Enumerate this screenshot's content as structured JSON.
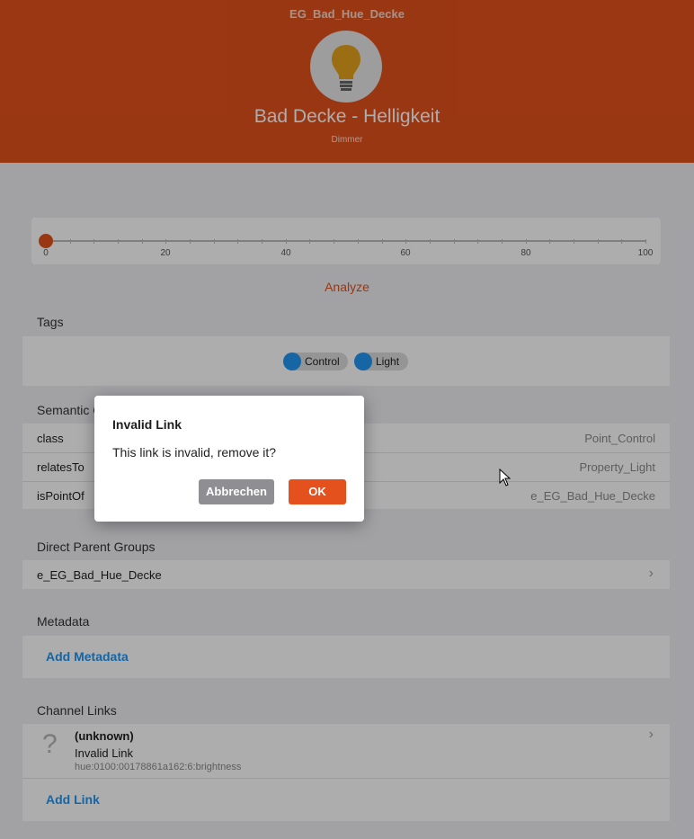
{
  "header": {
    "item_name": "EG_Bad_Hue_Decke",
    "title": "Bad Decke - Helligkeit",
    "type": "Dimmer",
    "icon": "lightbulb-icon",
    "color": "#e4511c"
  },
  "slider": {
    "value": 0,
    "min": 0,
    "max": 100,
    "labels": [
      "0",
      "20",
      "40",
      "60",
      "80",
      "100"
    ]
  },
  "analyze_label": "Analyze",
  "tags": {
    "heading": "Tags",
    "items": [
      "Control",
      "Light"
    ]
  },
  "semantic": {
    "heading": "Semantic C",
    "rows": [
      {
        "key": "class",
        "value": "Point_Control"
      },
      {
        "key": "relatesTo",
        "value": "Property_Light"
      },
      {
        "key": "isPointOf",
        "value": "e_EG_Bad_Hue_Decke"
      }
    ]
  },
  "parents": {
    "heading": "Direct Parent Groups",
    "group": "e_EG_Bad_Hue_Decke"
  },
  "metadata": {
    "heading": "Metadata",
    "add_label": "Add Metadata"
  },
  "channel_links": {
    "heading": "Channel Links",
    "link": {
      "title": "(unknown)",
      "status": "Invalid Link",
      "uid": "hue:0100:00178861a162:6:brightness"
    },
    "add_label": "Add Link"
  },
  "dialog": {
    "title": "Invalid Link",
    "text": "This link is invalid, remove it?",
    "cancel_label": "Abbrechen",
    "ok_label": "OK"
  }
}
